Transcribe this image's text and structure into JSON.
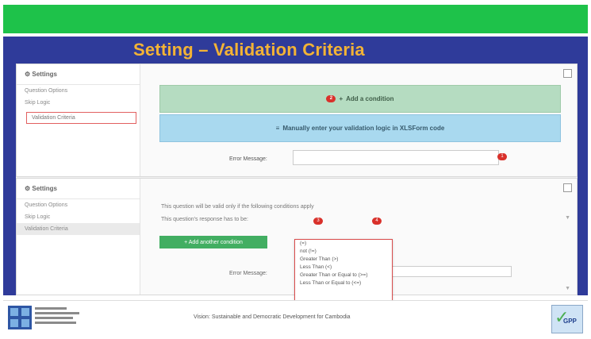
{
  "slide": {
    "title": "Setting – Validation Criteria"
  },
  "panel1": {
    "settings_header": "⚙ Settings",
    "sidebar": [
      "Question Options",
      "Skip Logic",
      "Validation Criteria"
    ],
    "add_condition": "Add a condition",
    "add_condition_badge": "2",
    "manual_logic": "Manually enter your validation logic in XLSForm code",
    "error_label": "Error Message:",
    "error_badge": "1"
  },
  "panel2": {
    "settings_header": "⚙ Settings",
    "sidebar": [
      "Question Options",
      "Skip Logic",
      "Validation Criteria"
    ],
    "condition_line1": "This question will be valid only if the following conditions apply",
    "condition_line2": "This question's response has to be:",
    "operator_badge": "3",
    "value_badge": "4",
    "add_another": "+ Add another condition",
    "error_label": "Error Message:",
    "operator_options": [
      "(=)",
      "not (!=)",
      "Greater Than (>)",
      "Less Than (<)",
      "Greater Than or Equal to (>=)",
      "Less Than or Equal to (<=)"
    ]
  },
  "footer": {
    "text": "Vision: Sustainable and Democratic Development for Cambodia"
  },
  "colors": {
    "top_bar": "#1ec24a",
    "slide_bg": "#2f3b9a",
    "title": "#f3b335",
    "add_condition_bg": "#b5dcc1",
    "manual_bg": "#a9d9ef",
    "badge": "#d9312b",
    "add_another_bg": "#42ae62"
  }
}
